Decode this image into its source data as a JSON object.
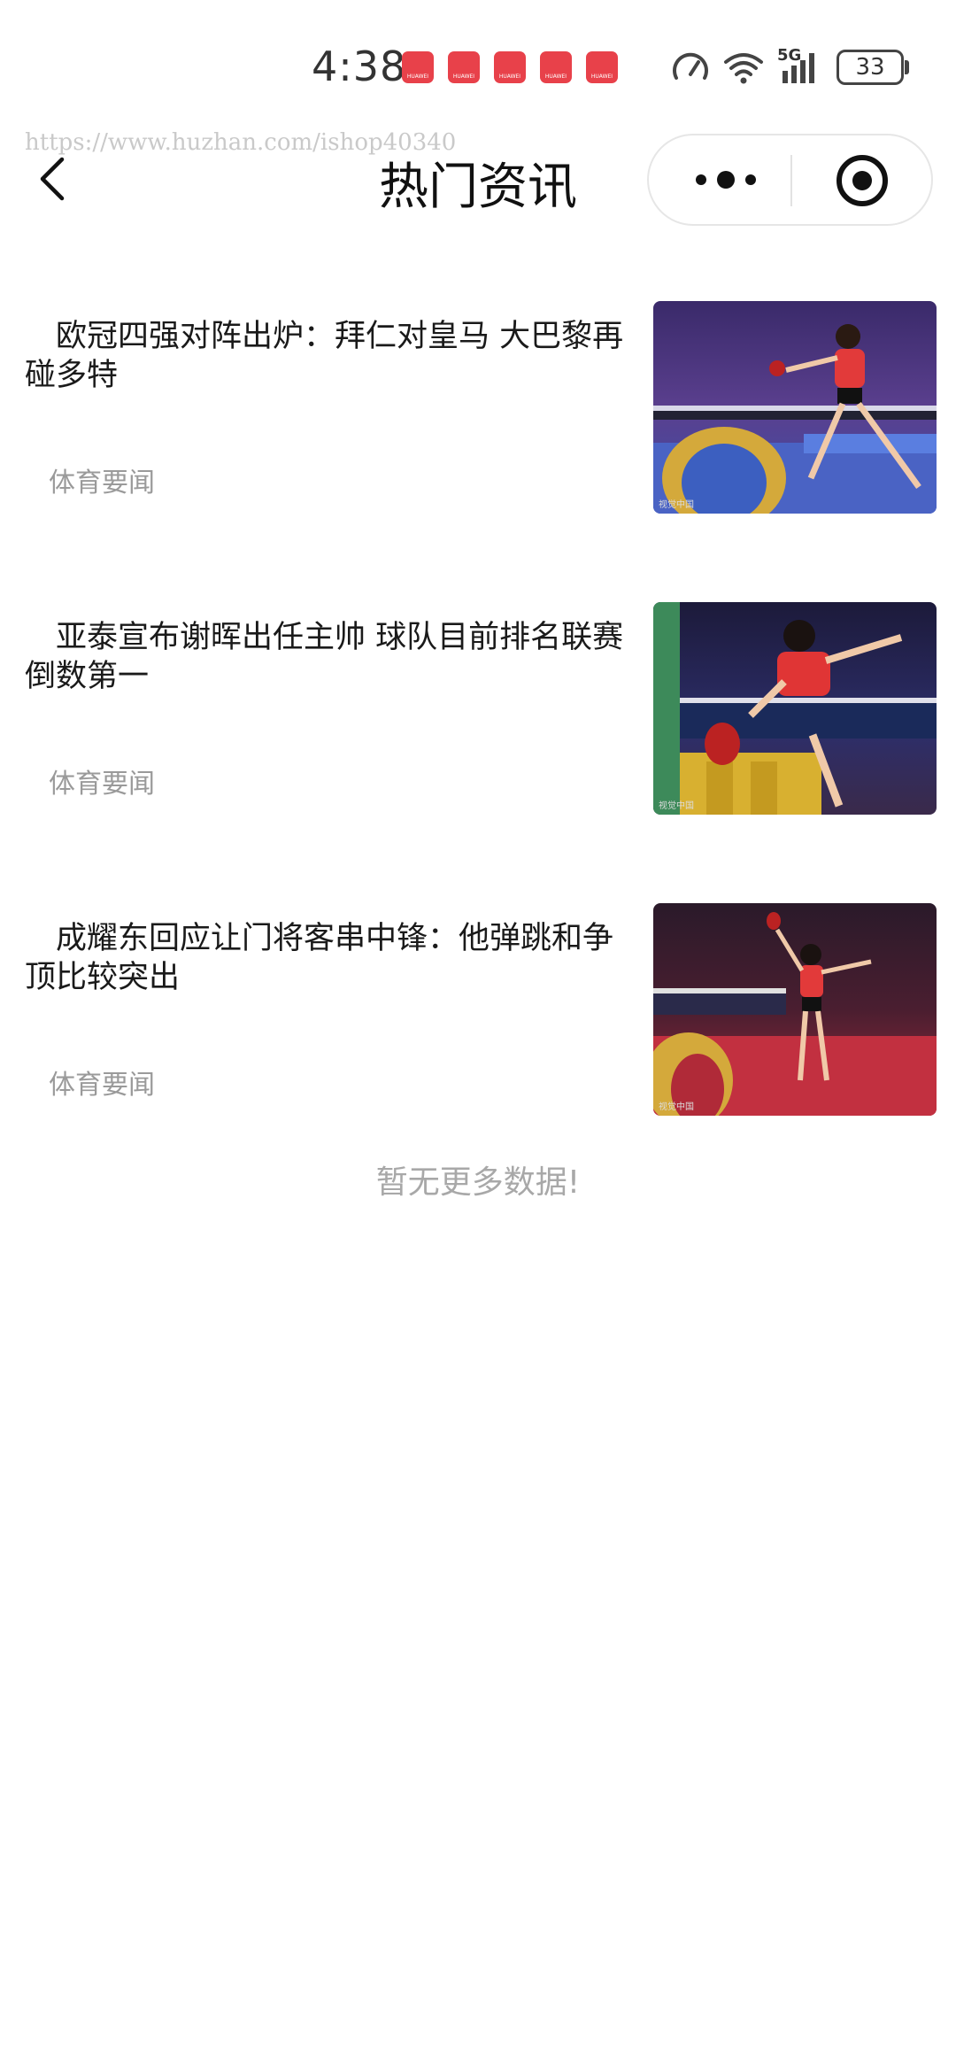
{
  "status_bar": {
    "time": "4:38",
    "notification_label": "HUAWEI",
    "network": "5G",
    "battery": "33"
  },
  "watermark": "https://www.huzhan.com/ishop40340",
  "nav": {
    "title": "热门资讯"
  },
  "news": [
    {
      "title": "欧冠四强对阵出炉：拜仁对皇马 大巴黎再碰多特",
      "source": "体育要闻",
      "image_caption": "视觉中国"
    },
    {
      "title": "亚泰宣布谢晖出任主帅 球队目前排名联赛倒数第一",
      "source": "体育要闻",
      "image_caption": "视觉中国"
    },
    {
      "title": "成耀东回应让门将客串中锋：他弹跳和争顶比较突出",
      "source": "体育要闻",
      "image_caption": "视觉中国"
    }
  ],
  "footer": {
    "no_more": "暂无更多数据!"
  },
  "colors": {
    "notification_red": "#e8414a",
    "muted_text": "#9a9a9a",
    "title_text": "#111111"
  }
}
